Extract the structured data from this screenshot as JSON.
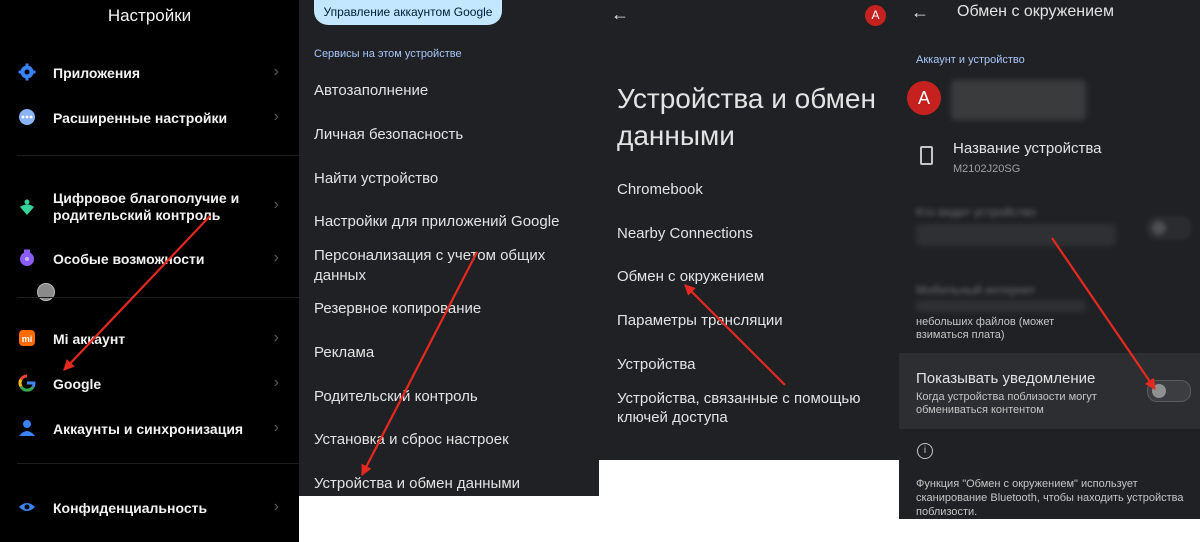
{
  "colors": {
    "arrow": "#e52920",
    "accent": "#a8c7fa",
    "avatar": "#c5221f",
    "manage_button": "#c2e7ff"
  },
  "panel1": {
    "title": "Настройки",
    "items": [
      {
        "label": "Приложения",
        "icon": "gear-icon"
      },
      {
        "label": "Расширенные настройки",
        "icon": "more-dots-icon"
      },
      {
        "label": "Цифровое благополучие и родительский контроль",
        "icon": "heart-person-icon"
      },
      {
        "label": "Особые возможности",
        "icon": "accessibility-icon"
      },
      {
        "label": "Mi аккаунт",
        "icon": "mi-icon"
      },
      {
        "label": "Google",
        "icon": "google-g-icon"
      },
      {
        "label": "Аккаунты и синхронизация",
        "icon": "person-icon"
      },
      {
        "label": "Конфиденциальность",
        "icon": "eye-icon"
      }
    ]
  },
  "panel2": {
    "manage_button": "Управление аккаунтом Google",
    "section_title": "Сервисы на этом устройстве",
    "items": [
      "Автозаполнение",
      "Личная безопасность",
      "Найти устройство",
      "Настройки для приложений Google",
      "Персонализация с учетом общих данных",
      "Резервное копирование",
      "Реклама",
      "Родительский контроль",
      "Установка и сброс настроек",
      "Устройства и обмен данными"
    ]
  },
  "panel3": {
    "avatar_letter": "A",
    "heading": "Устройства и обмен данными",
    "items": [
      "Chromebook",
      "Nearby Connections",
      "Обмен с окружением",
      "Параметры трансляции",
      "Устройства",
      "Устройства, связанные с помощью ключей доступа"
    ]
  },
  "panel4": {
    "title": "Обмен с окружением",
    "section_title": "Аккаунт и устройство",
    "avatar_letter": "A",
    "device_name_title": "Название устройства",
    "device_model": "M2102J20SG",
    "visibility_title": "Кто видит устройство",
    "mobile_data_title": "Мобильный интернет",
    "mobile_data_desc": "небольших файлов (может взиматься плата)",
    "notification_title": "Показывать уведомление",
    "notification_desc": "Когда устройства поблизости могут обмениваться контентом",
    "notification_enabled": false,
    "footer": "Функция \"Обмен с окружением\" использует сканирование Bluetooth, чтобы находить устройства поблизости."
  }
}
